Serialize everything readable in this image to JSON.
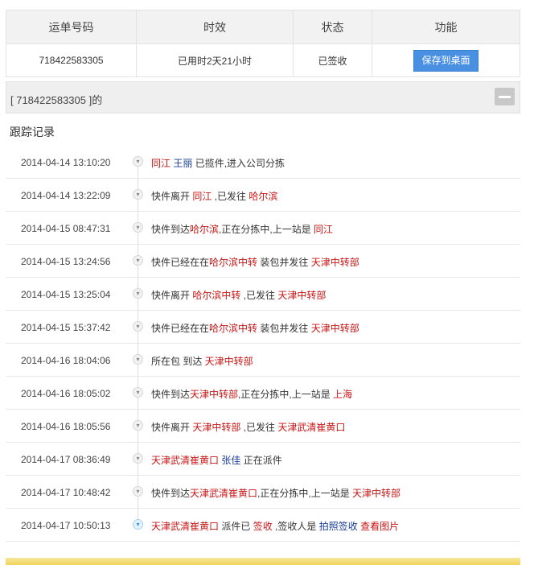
{
  "summary": {
    "headers": {
      "waybill": "运单号码",
      "time": "时效",
      "status": "状态",
      "function": "功能"
    },
    "waybill_no": "718422583305",
    "elapsed": "已用时2天21小时",
    "status": "已签收",
    "save_button": "保存到桌面"
  },
  "result_title": "[ 718422583305 ]的",
  "track_heading": "跟踪记录",
  "records": [
    {
      "time": "2014-04-14 13:10:20",
      "parts": [
        {
          "t": "同江",
          "c": "red"
        },
        {
          "t": " "
        },
        {
          "t": "王丽",
          "c": "blue"
        },
        {
          "t": " 已揽件,进入公司分拣"
        }
      ]
    },
    {
      "time": "2014-04-14 13:22:09",
      "parts": [
        {
          "t": "快件离开 "
        },
        {
          "t": "同江",
          "c": "red"
        },
        {
          "t": " ,已发往 "
        },
        {
          "t": "哈尔滨",
          "c": "red"
        }
      ]
    },
    {
      "time": "2014-04-15 08:47:31",
      "parts": [
        {
          "t": "快件到达"
        },
        {
          "t": "哈尔滨",
          "c": "red"
        },
        {
          "t": ",正在分拣中,上一站是 "
        },
        {
          "t": "同江",
          "c": "red"
        }
      ]
    },
    {
      "time": "2014-04-15 13:24:56",
      "parts": [
        {
          "t": "快件已经在在"
        },
        {
          "t": "哈尔滨中转",
          "c": "red"
        },
        {
          "t": " 装包并发往 "
        },
        {
          "t": "天津中转部",
          "c": "red"
        }
      ]
    },
    {
      "time": "2014-04-15 13:25:04",
      "parts": [
        {
          "t": "快件离开 "
        },
        {
          "t": "哈尔滨中转",
          "c": "red"
        },
        {
          "t": " ,已发往 "
        },
        {
          "t": "天津中转部",
          "c": "red"
        }
      ]
    },
    {
      "time": "2014-04-15 15:37:42",
      "parts": [
        {
          "t": "快件已经在在"
        },
        {
          "t": "哈尔滨中转",
          "c": "red"
        },
        {
          "t": " 装包并发往 "
        },
        {
          "t": "天津中转部",
          "c": "red"
        }
      ]
    },
    {
      "time": "2014-04-16 18:04:06",
      "parts": [
        {
          "t": "所在包 到达 "
        },
        {
          "t": "天津中转部",
          "c": "red"
        }
      ]
    },
    {
      "time": "2014-04-16 18:05:02",
      "parts": [
        {
          "t": "快件到达"
        },
        {
          "t": "天津中转部",
          "c": "red"
        },
        {
          "t": ",正在分拣中,上一站是 "
        },
        {
          "t": "上海",
          "c": "red"
        }
      ]
    },
    {
      "time": "2014-04-16 18:05:56",
      "parts": [
        {
          "t": "快件离开 "
        },
        {
          "t": "天津中转部",
          "c": "red"
        },
        {
          "t": " ,已发往 "
        },
        {
          "t": "天津武清崔黄口",
          "c": "red"
        }
      ]
    },
    {
      "time": "2014-04-17 08:36:49",
      "parts": [
        {
          "t": "天津武清崔黄口",
          "c": "red"
        },
        {
          "t": " "
        },
        {
          "t": "张佳",
          "c": "blue"
        },
        {
          "t": " 正在派件"
        }
      ]
    },
    {
      "time": "2014-04-17 10:48:42",
      "parts": [
        {
          "t": "快件到达"
        },
        {
          "t": "天津武清崔黄口",
          "c": "red"
        },
        {
          "t": ",正在分拣中,上一站是 "
        },
        {
          "t": "天津中转部",
          "c": "red"
        }
      ]
    },
    {
      "time": "2014-04-17 10:50:13",
      "parts": [
        {
          "t": "天津武清崔黄口",
          "c": "red"
        },
        {
          "t": " 派件已 "
        },
        {
          "t": "签收",
          "c": "red"
        },
        {
          "t": " ,签收人是 "
        },
        {
          "t": "拍照签收",
          "c": "blue"
        },
        {
          "t": " "
        },
        {
          "t": "查看图片",
          "c": "link"
        }
      ]
    }
  ],
  "colors": {
    "highlight_red": "#c81414",
    "highlight_blue": "#173c96",
    "button_blue": "#4a90e2"
  },
  "icons": {
    "expand": "chevron-down-icon",
    "collapse": "minus-icon"
  }
}
